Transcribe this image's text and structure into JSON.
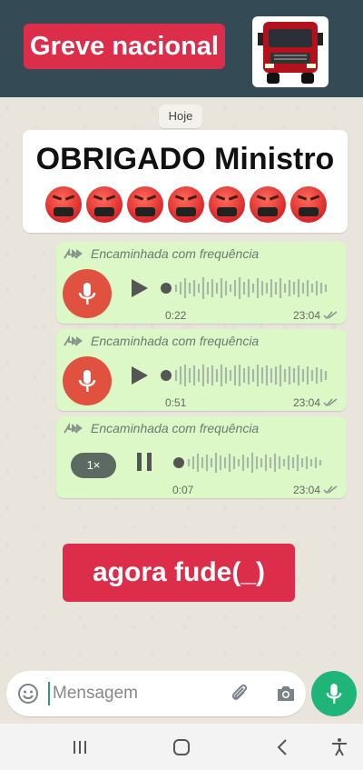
{
  "header": {
    "title": "Greve nacional",
    "image": "red-truck"
  },
  "chat": {
    "date_label": "Hoje",
    "card": {
      "title": "OBRIGADO Ministro",
      "emoji": "angry-face-with-symbols",
      "emoji_count": 7
    },
    "voice_messages": [
      {
        "forwarded_label": "Encaminhada com frequência",
        "duration": "0:22",
        "time": "23:04",
        "state": "paused",
        "avatar": "mic-icon"
      },
      {
        "forwarded_label": "Encaminhada com frequência",
        "duration": "0:51",
        "time": "23:04",
        "state": "paused",
        "avatar": "mic-icon"
      },
      {
        "forwarded_label": "Encaminhada com frequência",
        "duration": "0:07",
        "time": "23:04",
        "state": "playing",
        "speed": "1×"
      }
    ],
    "overlay_text": "agora fude(_)"
  },
  "composer": {
    "placeholder": "Mensagem"
  },
  "colors": {
    "header_bg": "#344a55",
    "accent_red": "#dc2d4a",
    "bubble_green": "#dcf8c6",
    "send_green": "#1fb478",
    "mic_red": "#e0523f"
  }
}
